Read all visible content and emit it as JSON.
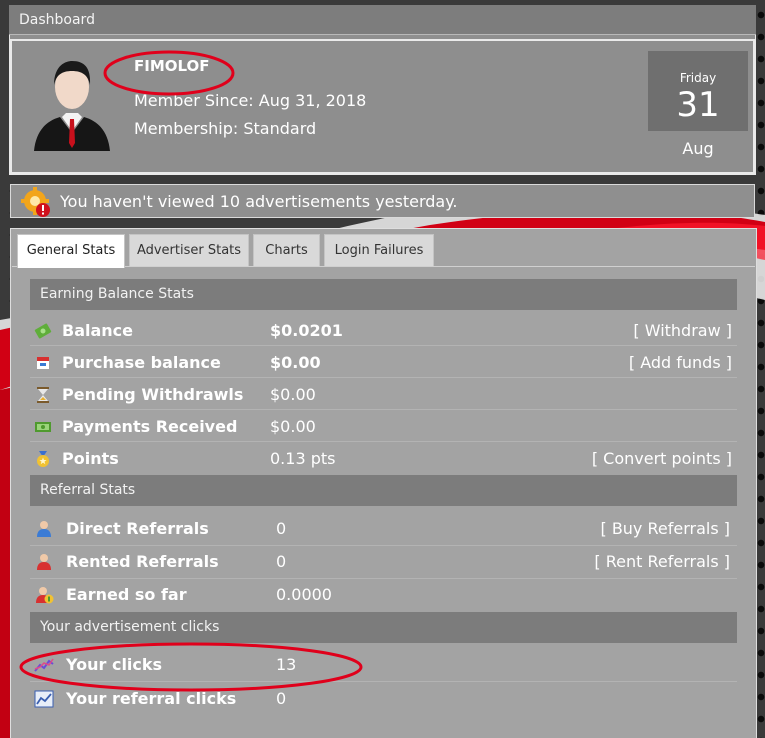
{
  "header": {
    "title": "Dashboard"
  },
  "profile": {
    "username": "FIMOLOF",
    "member_since": "Member Since: Aug 31, 2018",
    "membership": "Membership: Standard"
  },
  "date": {
    "weekday": "Friday",
    "day": "31",
    "month": "Aug"
  },
  "notice": {
    "text": "You haven't viewed 10 advertisements yesterday."
  },
  "tabs": [
    {
      "label": "General Stats",
      "active": true
    },
    {
      "label": "Advertiser Stats"
    },
    {
      "label": "Charts"
    },
    {
      "label": "Login Failures"
    }
  ],
  "earning": {
    "heading": "Earning Balance Stats",
    "rows": [
      {
        "label": "Balance",
        "value": "$0.0201",
        "action": "[ Withdraw ]",
        "icon": "money-icon"
      },
      {
        "label": "Purchase balance",
        "value": "$0.00",
        "action": "[ Add funds ]",
        "icon": "cart-icon"
      },
      {
        "label": "Pending Withdrawls",
        "value": "$0.00",
        "action": "",
        "icon": "hourglass-icon"
      },
      {
        "label": "Payments Received",
        "value": "$0.00",
        "action": "",
        "icon": "cash-icon"
      },
      {
        "label": "Points",
        "value": "0.13 pts",
        "action": "[ Convert points ]",
        "icon": "medal-icon"
      }
    ]
  },
  "referral": {
    "heading": "Referral Stats",
    "rows": [
      {
        "label": "Direct Referrals",
        "value": "0",
        "action": "[ Buy Referrals ]",
        "icon": "user-icon"
      },
      {
        "label": "Rented Referrals",
        "value": "0",
        "action": "[ Rent Referrals ]",
        "icon": "user-icon"
      },
      {
        "label": "Earned so far",
        "value": "0.0000",
        "action": "",
        "icon": "user-money-icon"
      }
    ]
  },
  "clicks": {
    "heading": "Your advertisement clicks",
    "rows": [
      {
        "label": "Your clicks",
        "value": "13",
        "icon": "chart-line-icon"
      },
      {
        "label": "Your referral clicks",
        "value": "0",
        "icon": "chart-icon"
      }
    ]
  },
  "colors": {
    "accent_red": "#e0001b",
    "panel": "#8f8f8f",
    "section_head": "#7c7c7c"
  }
}
